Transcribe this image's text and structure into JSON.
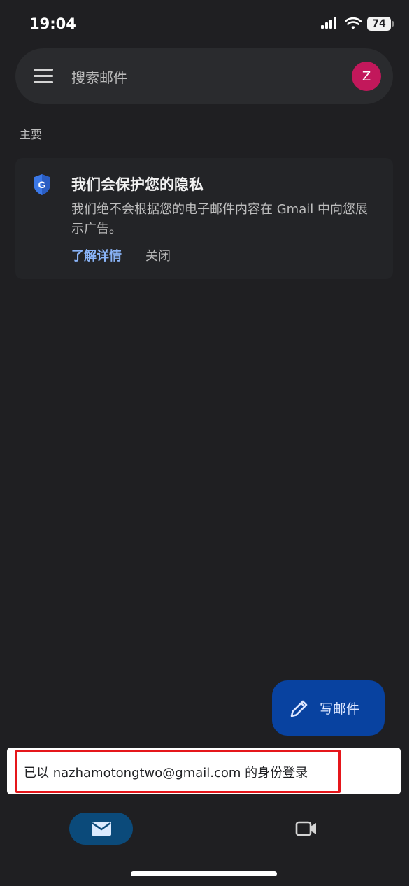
{
  "status_bar": {
    "time": "19:04",
    "battery": "74"
  },
  "search": {
    "placeholder": "搜索邮件",
    "avatar_letter": "Z"
  },
  "inbox": {
    "section_label": "主要"
  },
  "privacy_card": {
    "title": "我们会保护您的隐私",
    "body": "我们绝不会根据您的电子邮件内容在 Gmail 中向您展示广告。",
    "learn_more": "了解详情",
    "close": "关闭"
  },
  "compose": {
    "label": "写邮件"
  },
  "snackbar": {
    "message": "已以 nazhamotongtwo@gmail.com 的身份登录"
  },
  "colors": {
    "background": "#1f1f22",
    "accent_blue": "#8ab4f8",
    "fab": "#0842a0",
    "avatar": "#c2185b",
    "highlight": "#e5161b"
  },
  "icons": {
    "menu": "hamburger-menu-icon",
    "shield": "google-shield-icon",
    "compose": "pencil-icon",
    "mail": "mail-icon",
    "meet": "video-camera-icon"
  }
}
